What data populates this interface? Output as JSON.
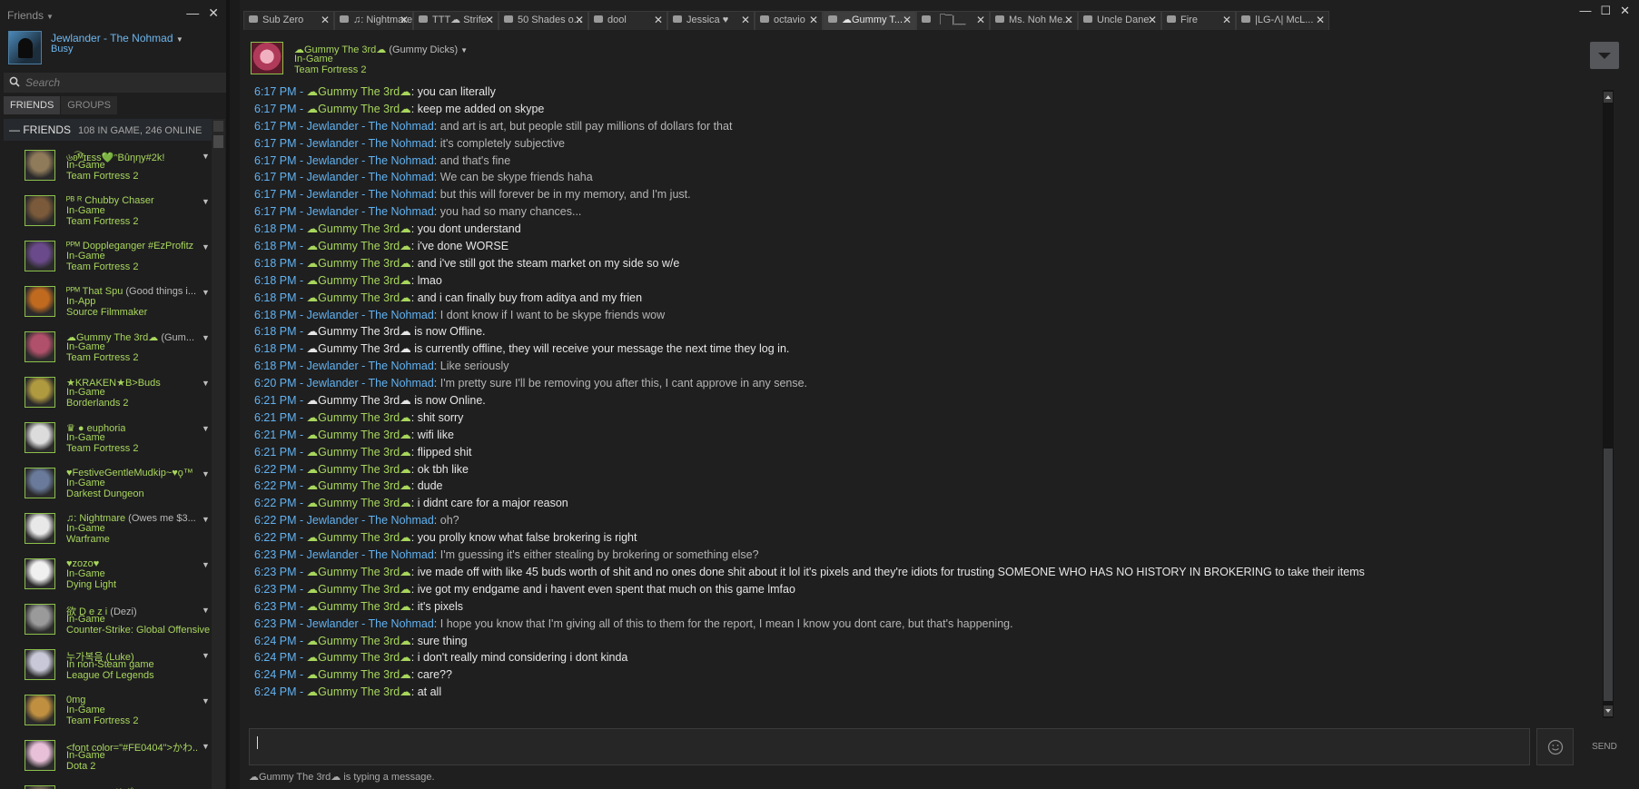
{
  "friends_panel": {
    "title": "Friends",
    "me": {
      "name": "Jewlander - The Nohmad",
      "status": "Busy"
    },
    "search_placeholder": "Search",
    "tabs": [
      "FRIENDS",
      "GROUPS"
    ],
    "group": {
      "label": "FRIENDS",
      "counts": "108 IN GAME, 246 ONLINE"
    },
    "friends": [
      {
        "name": "৬ʚ͡͡ᴹɪᴇѕѕ💚ᵔBûηηу#2k!",
        "ext": "",
        "state": "In-Game",
        "game": "Team Fortress 2",
        "color": "#8f7a5a"
      },
      {
        "name": "ᴾᴮ ᴿ Chubby Chaser",
        "ext": "",
        "state": "In-Game",
        "game": "Team Fortress 2",
        "color": "#7a5a3a"
      },
      {
        "name": "ᴾᴾᴹ Doppleganger #EzProfitz",
        "ext": "",
        "state": "In-Game",
        "game": "Team Fortress 2",
        "color": "#6a4a8a"
      },
      {
        "name": "ᴾᴾᴹ That Spu",
        "ext": " (Good things i...",
        "state": "In-App",
        "game": "Source Filmmaker",
        "color": "#c06a20"
      },
      {
        "name": "☁Gummy The 3rd☁",
        "ext": " (Gum...",
        "state": "In-Game",
        "game": "Team Fortress 2",
        "color": "#b0506a"
      },
      {
        "name": "★KRAKEN★B>Buds",
        "ext": "",
        "state": "In-Game",
        "game": "Borderlands 2",
        "color": "#b09a40"
      },
      {
        "name": "♛ ● euphoria",
        "ext": "",
        "state": "In-Game",
        "game": "Team Fortress 2",
        "color": "#dcdcdc"
      },
      {
        "name": "♥FestiveGentleMudkip~♥ϙ™",
        "ext": "",
        "state": "In-Game",
        "game": "Darkest Dungeon",
        "color": "#6a7a9a"
      },
      {
        "name": "♫: Nightmare",
        "ext": " (Owes me $3...",
        "state": "In-Game",
        "game": "Warframe",
        "color": "#e8e8e8"
      },
      {
        "name": "♥zozo♥",
        "ext": "",
        "state": "In-Game",
        "game": "Dying Light",
        "color": "#f0f0f0"
      },
      {
        "name": "欲 D e z i",
        "ext": " (Dezi)",
        "state": "In-Game",
        "game": "Counter-Strike: Global Offensive",
        "color": "#9a9a9a"
      },
      {
        "name": "누가복음 (Luke)",
        "ext": "",
        "state": "In non-Steam game",
        "game": "League Of Legends",
        "color": "#c8c8d8"
      },
      {
        "name": "0mg",
        "ext": "",
        "state": "In-Game",
        "game": "Team Fortress 2",
        "color": "#c09040"
      },
      {
        "name": "<font color=\"#FE0404\">かわ...",
        "ext": "",
        "state": "In-Game",
        "game": "Dota 2",
        "color": "#e8c0d8"
      },
      {
        "name": "ᴿᴮ Conklin サポ ♪ tutuu",
        "ext": "",
        "state": "In-Game",
        "game": "",
        "color": "#7a6a5a"
      }
    ]
  },
  "tabs": [
    {
      "label": "Sub Zero",
      "active": false
    },
    {
      "label": "♫: Nightmare",
      "active": false
    },
    {
      "label": "TTT☁ Strife",
      "active": false
    },
    {
      "label": "50 Shades o...",
      "active": false
    },
    {
      "label": "dool",
      "active": false
    },
    {
      "label": "Jessica ♥",
      "active": false
    },
    {
      "label": "octavio",
      "active": false
    },
    {
      "label": "☁Gummy T...",
      "active": true
    },
    {
      "label": "⎾‾‾|__",
      "active": false
    },
    {
      "label": "Ms. Noh Me...",
      "active": false
    },
    {
      "label": "Uncle Dane",
      "active": false
    },
    {
      "label": "Fire",
      "active": false
    },
    {
      "label": "|LG-Λ| McL...",
      "active": false
    }
  ],
  "chat_header": {
    "name": "☁Gummy The 3rd☁",
    "nickname": " (Gummy Dicks)",
    "state": "In-Game",
    "game": "Team Fortress 2"
  },
  "messages": [
    {
      "time": "6:17 PM",
      "who": "g",
      "name": "☁Gummy The 3rd☁",
      "text": "you can literally"
    },
    {
      "time": "6:17 PM",
      "who": "g",
      "name": "☁Gummy The 3rd☁",
      "text": "keep me added on skype"
    },
    {
      "time": "6:17 PM",
      "who": "j",
      "name": "Jewlander - The Nohmad",
      "text": "and art is art, but people still pay millions of dollars for that"
    },
    {
      "time": "6:17 PM",
      "who": "j",
      "name": "Jewlander - The Nohmad",
      "text": "it's completely subjective"
    },
    {
      "time": "6:17 PM",
      "who": "j",
      "name": "Jewlander - The Nohmad",
      "text": "and that's fine"
    },
    {
      "time": "6:17 PM",
      "who": "j",
      "name": "Jewlander - The Nohmad",
      "text": "We can be skype friends haha"
    },
    {
      "time": "6:17 PM",
      "who": "j",
      "name": "Jewlander - The Nohmad",
      "text": "but this will forever be in my memory, and I'm just."
    },
    {
      "time": "6:17 PM",
      "who": "j",
      "name": "Jewlander - The Nohmad",
      "text": "you had so many chances..."
    },
    {
      "time": "6:18 PM",
      "who": "g",
      "name": "☁Gummy The 3rd☁",
      "text": "you dont understand"
    },
    {
      "time": "6:18 PM",
      "who": "g",
      "name": "☁Gummy The 3rd☁",
      "text": "i've done WORSE"
    },
    {
      "time": "6:18 PM",
      "who": "g",
      "name": "☁Gummy The 3rd☁",
      "text": "and i've still got  the steam market on my side so w/e"
    },
    {
      "time": "6:18 PM",
      "who": "g",
      "name": "☁Gummy The 3rd☁",
      "text": "lmao"
    },
    {
      "time": "6:18 PM",
      "who": "g",
      "name": "☁Gummy The 3rd☁",
      "text": "and i can finally buy from aditya and my frien"
    },
    {
      "time": "6:18 PM",
      "who": "j",
      "name": "Jewlander - The Nohmad",
      "text": "I dont know if I want to be skype friends wow"
    },
    {
      "time": "6:18 PM",
      "who": "s",
      "name": "☁Gummy The 3rd☁",
      "text": "is now Offline."
    },
    {
      "time": "6:18 PM",
      "who": "s",
      "name": "☁Gummy The 3rd☁",
      "text": "is currently offline, they will receive your message the next time they log in."
    },
    {
      "time": "6:18 PM",
      "who": "j",
      "name": "Jewlander - The Nohmad",
      "text": "Like seriously"
    },
    {
      "time": "6:20 PM",
      "who": "j",
      "name": "Jewlander - The Nohmad",
      "text": "I'm pretty sure I'll be removing you after this, I cant approve in any sense."
    },
    {
      "time": "6:21 PM",
      "who": "s",
      "name": "☁Gummy The 3rd☁",
      "text": "is now Online."
    },
    {
      "time": "6:21 PM",
      "who": "g",
      "name": "☁Gummy The 3rd☁",
      "text": "shit sorry"
    },
    {
      "time": "6:21 PM",
      "who": "g",
      "name": "☁Gummy The 3rd☁",
      "text": "wifi like"
    },
    {
      "time": "6:21 PM",
      "who": "g",
      "name": "☁Gummy The 3rd☁",
      "text": "flipped shit"
    },
    {
      "time": "6:22 PM",
      "who": "g",
      "name": "☁Gummy The 3rd☁",
      "text": "ok tbh like"
    },
    {
      "time": "6:22 PM",
      "who": "g",
      "name": "☁Gummy The 3rd☁",
      "text": "dude"
    },
    {
      "time": "6:22 PM",
      "who": "g",
      "name": "☁Gummy The 3rd☁",
      "text": "i didnt care for a major reason"
    },
    {
      "time": "6:22 PM",
      "who": "j",
      "name": "Jewlander - The Nohmad",
      "text": "oh?"
    },
    {
      "time": "6:22 PM",
      "who": "g",
      "name": "☁Gummy The 3rd☁",
      "text": "you prolly know what false brokering is right"
    },
    {
      "time": "6:23 PM",
      "who": "j",
      "name": "Jewlander - The Nohmad",
      "text": "I'm guessing it's either stealing by brokering or something else?"
    },
    {
      "time": "6:23 PM",
      "who": "g",
      "name": "☁Gummy The 3rd☁",
      "text": "ive made off with like 45 buds worth of shit and no ones done shit about it lol it's pixels and they're idiots for trusting SOMEONE WHO HAS NO HISTORY IN BROKERING to take their items"
    },
    {
      "time": "6:23 PM",
      "who": "g",
      "name": "☁Gummy The 3rd☁",
      "text": "ive got my endgame and i havent even spent that much on this game lmfao"
    },
    {
      "time": "6:23 PM",
      "who": "g",
      "name": "☁Gummy The 3rd☁",
      "text": "it's pixels"
    },
    {
      "time": "6:23 PM",
      "who": "j",
      "name": "Jewlander - The Nohmad",
      "text": "I hope you know that I'm giving all of this to them for the report, I mean I know you dont care, but that's happening."
    },
    {
      "time": "6:24 PM",
      "who": "g",
      "name": "☁Gummy The 3rd☁",
      "text": "sure thing"
    },
    {
      "time": "6:24 PM",
      "who": "g",
      "name": "☁Gummy The 3rd☁",
      "text": "i don't really mind considering i dont kinda"
    },
    {
      "time": "6:24 PM",
      "who": "g",
      "name": "☁Gummy The 3rd☁",
      "text": "care??"
    },
    {
      "time": "6:24 PM",
      "who": "g",
      "name": "☁Gummy The 3rd☁",
      "text": "at all"
    }
  ],
  "input": {
    "value": "",
    "send_label": "SEND"
  },
  "typing_indicator": "☁Gummy The 3rd☁ is typing a message.",
  "colors": {
    "friend_green": "#a8d65c",
    "self_blue": "#62b2f0",
    "background": "#1f1f20"
  }
}
